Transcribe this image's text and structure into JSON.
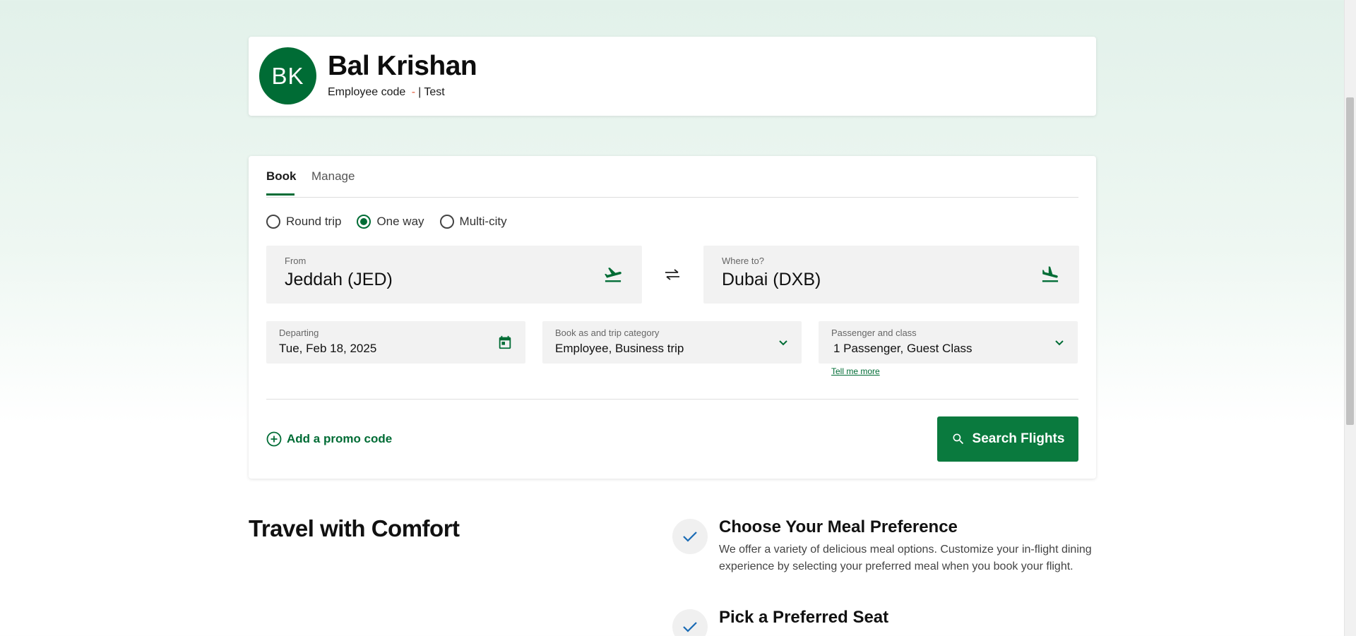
{
  "profile": {
    "initials": "BK",
    "name": "Bal Krishan",
    "employee_code_label": "Employee code",
    "employee_code_value": "-",
    "separator": "|",
    "employee_type": "Test"
  },
  "booking": {
    "tabs": [
      {
        "label": "Book",
        "active": true
      },
      {
        "label": "Manage",
        "active": false
      }
    ],
    "trip_types": [
      {
        "label": "Round trip",
        "selected": false
      },
      {
        "label": "One way",
        "selected": true
      },
      {
        "label": "Multi-city",
        "selected": false
      }
    ],
    "from": {
      "label": "From",
      "value": "Jeddah (JED)",
      "icon": "plane-takeoff-icon"
    },
    "to": {
      "label": "Where to?",
      "value": "Dubai (DXB)",
      "icon": "plane-landing-icon"
    },
    "departing": {
      "label": "Departing",
      "value": "Tue, Feb 18, 2025",
      "icon": "calendar-icon"
    },
    "category": {
      "label": "Book as and trip category",
      "value": "Employee, Business trip"
    },
    "passenger": {
      "label": "Passenger and class",
      "value": "1 Passenger, Guest Class"
    },
    "tell_more": "Tell me more",
    "promo": "Add a promo code",
    "search_button": "Search Flights"
  },
  "comfort": {
    "title": "Travel with Comfort",
    "features": [
      {
        "title": "Choose Your Meal Preference",
        "description": "We offer a variety of delicious meal options. Customize your in-flight dining experience by selecting your preferred meal when you book your flight."
      },
      {
        "title": "Pick a Preferred Seat",
        "description": ""
      }
    ]
  },
  "colors": {
    "brand_green": "#006c35",
    "button_green": "#0a7a3e",
    "accent_check": "#1a6bb5"
  }
}
